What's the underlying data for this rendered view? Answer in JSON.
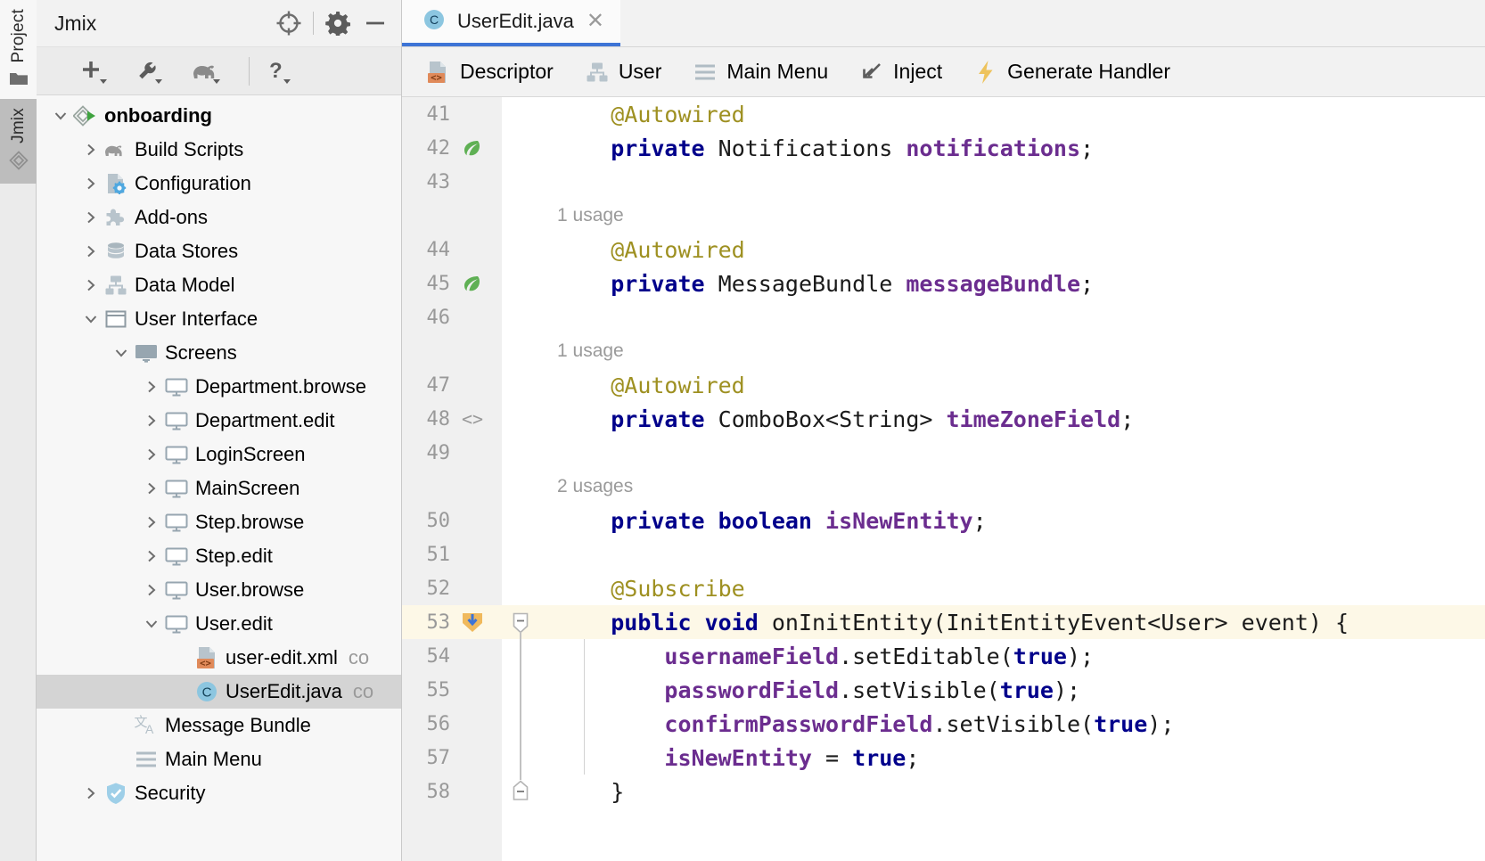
{
  "window": {
    "vertical_tabs": [
      {
        "label": "Project",
        "icon": "folder-icon",
        "selected": true
      },
      {
        "label": "Jmix",
        "icon": "jmix-diamond-icon",
        "selected": false
      }
    ]
  },
  "project_panel": {
    "title": "Jmix",
    "header_buttons": [
      {
        "name": "locate-target-button",
        "icon": "crosshair-icon"
      },
      {
        "name": "settings-button",
        "icon": "gear-icon"
      },
      {
        "name": "hide-button",
        "icon": "minimize-icon"
      }
    ],
    "toolbar_buttons": [
      {
        "name": "new-button",
        "icon": "plus-dropdown-icon"
      },
      {
        "name": "tools-button",
        "icon": "wrench-dropdown-icon"
      },
      {
        "name": "gradle-button",
        "icon": "elephant-dropdown-icon"
      },
      {
        "name": "help-button",
        "icon": "question-dropdown-icon"
      }
    ],
    "tree": [
      {
        "label": "onboarding",
        "icon": "jmix-project-run-icon",
        "indent": 0,
        "arrow": "down",
        "bold": true,
        "comment": ""
      },
      {
        "label": "Build Scripts",
        "icon": "gradle-elephant-icon",
        "indent": 1,
        "arrow": "right",
        "bold": false,
        "comment": ""
      },
      {
        "label": "Configuration",
        "icon": "configuration-icon",
        "indent": 1,
        "arrow": "right",
        "bold": false,
        "comment": ""
      },
      {
        "label": "Add-ons",
        "icon": "puzzle-icon",
        "indent": 1,
        "arrow": "right",
        "bold": false,
        "comment": ""
      },
      {
        "label": "Data Stores",
        "icon": "database-icon",
        "indent": 1,
        "arrow": "right",
        "bold": false,
        "comment": ""
      },
      {
        "label": "Data Model",
        "icon": "data-model-icon",
        "indent": 1,
        "arrow": "right",
        "bold": false,
        "comment": ""
      },
      {
        "label": "User Interface",
        "icon": "window-icon",
        "indent": 1,
        "arrow": "down",
        "bold": false,
        "comment": ""
      },
      {
        "label": "Screens",
        "icon": "monitor-filled-icon",
        "indent": 2,
        "arrow": "down",
        "bold": false,
        "comment": ""
      },
      {
        "label": "Department.browse",
        "icon": "screen-icon",
        "indent": 3,
        "arrow": "right",
        "bold": false,
        "comment": ""
      },
      {
        "label": "Department.edit",
        "icon": "screen-icon",
        "indent": 3,
        "arrow": "right",
        "bold": false,
        "comment": ""
      },
      {
        "label": "LoginScreen",
        "icon": "screen-icon",
        "indent": 3,
        "arrow": "right",
        "bold": false,
        "comment": ""
      },
      {
        "label": "MainScreen",
        "icon": "screen-icon",
        "indent": 3,
        "arrow": "right",
        "bold": false,
        "comment": ""
      },
      {
        "label": "Step.browse",
        "icon": "screen-icon",
        "indent": 3,
        "arrow": "right",
        "bold": false,
        "comment": ""
      },
      {
        "label": "Step.edit",
        "icon": "screen-icon",
        "indent": 3,
        "arrow": "right",
        "bold": false,
        "comment": ""
      },
      {
        "label": "User.browse",
        "icon": "screen-icon",
        "indent": 3,
        "arrow": "right",
        "bold": false,
        "comment": ""
      },
      {
        "label": "User.edit",
        "icon": "screen-icon",
        "indent": 3,
        "arrow": "down",
        "bold": false,
        "comment": ""
      },
      {
        "label": "user-edit.xml",
        "icon": "xml-descriptor-icon",
        "indent": 4,
        "arrow": "none",
        "bold": false,
        "comment": "co",
        "selected": false
      },
      {
        "label": "UserEdit.java",
        "icon": "java-class-icon",
        "indent": 4,
        "arrow": "none",
        "bold": false,
        "comment": "co",
        "selected": true
      },
      {
        "label": "Message Bundle",
        "icon": "translate-icon",
        "indent": 2,
        "arrow": "none",
        "bold": false,
        "comment": ""
      },
      {
        "label": "Main Menu",
        "icon": "hamburger-icon",
        "indent": 2,
        "arrow": "none",
        "bold": false,
        "comment": ""
      },
      {
        "label": "Security",
        "icon": "shield-check-icon",
        "indent": 1,
        "arrow": "right",
        "bold": false,
        "comment": ""
      }
    ]
  },
  "editor": {
    "tab": {
      "label": "UserEdit.java",
      "icon": "java-class-icon",
      "close_icon": "close-icon"
    },
    "toolbar": [
      {
        "label": "Descriptor",
        "icon": "xml-descriptor-icon"
      },
      {
        "label": "User",
        "icon": "data-model-icon"
      },
      {
        "label": "Main Menu",
        "icon": "hamburger-icon"
      },
      {
        "label": "Inject",
        "icon": "inject-arrow-icon"
      },
      {
        "label": "Generate Handler",
        "icon": "lightning-bolt-icon"
      }
    ],
    "first_visible_line": 41,
    "lines": [
      {
        "num": 41,
        "gutter_icon": "",
        "highlight": false,
        "indent": 1,
        "tokens": [
          {
            "t": "@Autowired",
            "c": "ann"
          }
        ]
      },
      {
        "num": 42,
        "gutter_icon": "spring-bean-icon",
        "highlight": false,
        "indent": 1,
        "tokens": [
          {
            "t": "private ",
            "c": "kw"
          },
          {
            "t": "Notifications ",
            "c": "typ"
          },
          {
            "t": "notifications",
            "c": "fld"
          },
          {
            "t": ";",
            "c": "pln"
          }
        ]
      },
      {
        "num": 43,
        "gutter_icon": "",
        "highlight": false,
        "indent": 0,
        "tokens": []
      },
      {
        "num": null,
        "usage": "1 usage"
      },
      {
        "num": 44,
        "gutter_icon": "",
        "highlight": false,
        "indent": 1,
        "tokens": [
          {
            "t": "@Autowired",
            "c": "ann"
          }
        ]
      },
      {
        "num": 45,
        "gutter_icon": "spring-bean-icon",
        "highlight": false,
        "indent": 1,
        "tokens": [
          {
            "t": "private ",
            "c": "kw"
          },
          {
            "t": "MessageBundle ",
            "c": "typ"
          },
          {
            "t": "messageBundle",
            "c": "fld"
          },
          {
            "t": ";",
            "c": "pln"
          }
        ]
      },
      {
        "num": 46,
        "gutter_icon": "",
        "highlight": false,
        "indent": 0,
        "tokens": []
      },
      {
        "num": null,
        "usage": "1 usage"
      },
      {
        "num": 47,
        "gutter_icon": "",
        "highlight": false,
        "indent": 1,
        "tokens": [
          {
            "t": "@Autowired",
            "c": "ann"
          }
        ]
      },
      {
        "num": 48,
        "gutter_icon": "xml-link-icon",
        "highlight": false,
        "indent": 1,
        "tokens": [
          {
            "t": "private ",
            "c": "kw"
          },
          {
            "t": "ComboBox<String> ",
            "c": "typ"
          },
          {
            "t": "timeZoneField",
            "c": "fld"
          },
          {
            "t": ";",
            "c": "pln"
          }
        ]
      },
      {
        "num": 49,
        "gutter_icon": "",
        "highlight": false,
        "indent": 0,
        "tokens": []
      },
      {
        "num": null,
        "usage": "2 usages"
      },
      {
        "num": 50,
        "gutter_icon": "",
        "highlight": false,
        "indent": 1,
        "tokens": [
          {
            "t": "private boolean ",
            "c": "kw"
          },
          {
            "t": "isNewEntity",
            "c": "fld"
          },
          {
            "t": ";",
            "c": "pln"
          }
        ]
      },
      {
        "num": 51,
        "gutter_icon": "",
        "highlight": false,
        "indent": 0,
        "tokens": []
      },
      {
        "num": 52,
        "gutter_icon": "",
        "highlight": false,
        "indent": 1,
        "tokens": [
          {
            "t": "@Subscribe",
            "c": "ann"
          }
        ]
      },
      {
        "num": 53,
        "gutter_icon": "event-handler-icon",
        "fold": "collapse-start",
        "highlight": true,
        "indent": 1,
        "tokens": [
          {
            "t": "public void ",
            "c": "kw"
          },
          {
            "t": "onInitEntity",
            "c": "mth"
          },
          {
            "t": "(InitEntityEvent<User> event) {",
            "c": "pln"
          }
        ]
      },
      {
        "num": 54,
        "gutter_icon": "",
        "highlight": false,
        "indent": 2,
        "tokens": [
          {
            "t": "usernameField",
            "c": "fld"
          },
          {
            "t": ".setEditable(",
            "c": "pln"
          },
          {
            "t": "true",
            "c": "kw"
          },
          {
            "t": ");",
            "c": "pln"
          }
        ]
      },
      {
        "num": 55,
        "gutter_icon": "",
        "highlight": false,
        "indent": 2,
        "tokens": [
          {
            "t": "passwordField",
            "c": "fld"
          },
          {
            "t": ".setVisible(",
            "c": "pln"
          },
          {
            "t": "true",
            "c": "kw"
          },
          {
            "t": ");",
            "c": "pln"
          }
        ]
      },
      {
        "num": 56,
        "gutter_icon": "",
        "highlight": false,
        "indent": 2,
        "tokens": [
          {
            "t": "confirmPasswordField",
            "c": "fld"
          },
          {
            "t": ".setVisible(",
            "c": "pln"
          },
          {
            "t": "true",
            "c": "kw"
          },
          {
            "t": ");",
            "c": "pln"
          }
        ]
      },
      {
        "num": 57,
        "gutter_icon": "",
        "highlight": false,
        "indent": 2,
        "tokens": [
          {
            "t": "isNewEntity",
            "c": "fld"
          },
          {
            "t": " = ",
            "c": "pln"
          },
          {
            "t": "true",
            "c": "kw"
          },
          {
            "t": ";",
            "c": "pln"
          }
        ]
      },
      {
        "num": 58,
        "gutter_icon": "",
        "fold": "collapse-end",
        "highlight": false,
        "indent": 1,
        "tokens": [
          {
            "t": "}",
            "c": "pln"
          }
        ]
      }
    ]
  },
  "colors": {
    "accent_tab_underline": "#3d74d6",
    "selection_gray": "#d4d4d4",
    "highlight_line": "#fdf8e7",
    "keyword": "#00008b",
    "annotation": "#9e9021",
    "field": "#6b2d8f",
    "gutter_bg": "#f0f0f0",
    "panel_bg": "#f7f7f7",
    "descriptor_orange": "#e08a5a",
    "bolt_yellow": "#eec35c",
    "java_blue": "#8cc6e0",
    "shield_blue": "#9ecfe8"
  }
}
